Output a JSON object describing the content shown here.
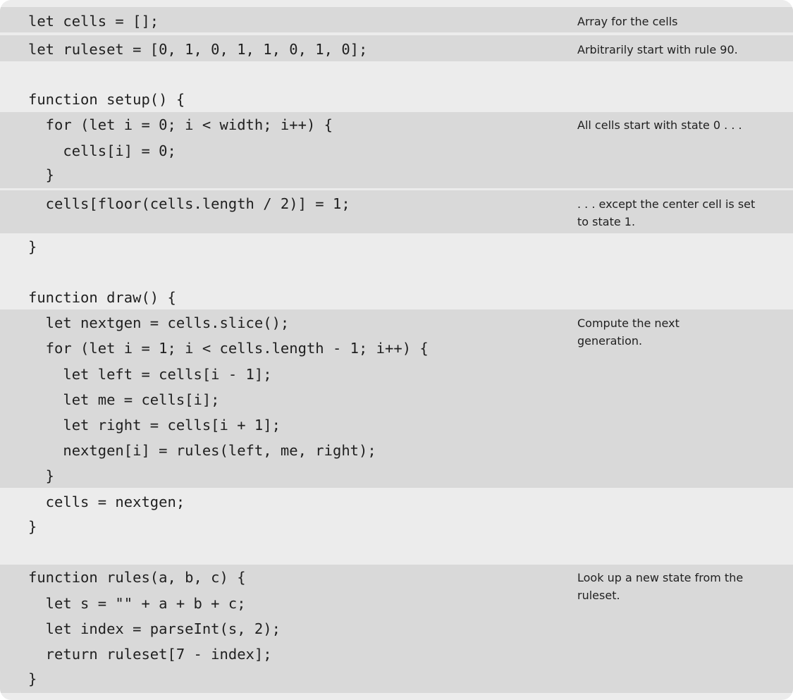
{
  "code_lines": [
    "let cells = [];",
    "let ruleset = [0, 1, 0, 1, 1, 0, 1, 0];",
    "function setup() {",
    "  for (let i = 0; i < width; i++) {",
    "    cells[i] = 0;",
    "  }",
    "  cells[floor(cells.length / 2)] = 1;",
    "}",
    "function draw() {",
    "  let nextgen = cells.slice();",
    "  for (let i = 1; i < cells.length - 1; i++) {",
    "    let left = cells[i - 1];",
    "    let me = cells[i];",
    "    let right = cells[i + 1];",
    "    nextgen[i] = rules(left, me, right);",
    "  }",
    "  cells = nextgen;",
    "}",
    "function rules(a, b, c) {",
    "  let s = \"\" + a + b + c;",
    "  let index = parseInt(s, 2);",
    "  return ruleset[7 - index];",
    "}"
  ],
  "annotations": [
    "Array for the cells",
    "Arbitrarily start with rule 90.",
    "All cells start with state 0 . . .",
    ". . . except the center cell is set to state 1.",
    "Compute the next generation.",
    "Look up a new state from the ruleset."
  ]
}
